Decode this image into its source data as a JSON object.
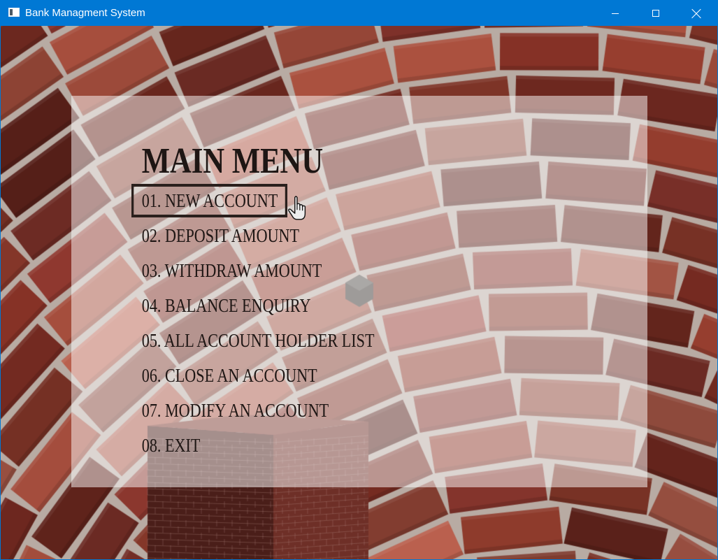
{
  "window": {
    "title": "Bank Managment System",
    "app_icon": "app-window-icon",
    "controls": {
      "minimize_icon": "minimize-icon",
      "maximize_icon": "maximize-icon",
      "close_icon": "close-icon"
    }
  },
  "menu": {
    "title": "MAIN MENU",
    "items": [
      {
        "label": "01. NEW ACCOUNT"
      },
      {
        "label": "02. DEPOSIT AMOUNT"
      },
      {
        "label": "03. WITHDRAW AMOUNT"
      },
      {
        "label": "04. BALANCE ENQUIRY"
      },
      {
        "label": "05. ALL ACCOUNT HOLDER LIST"
      },
      {
        "label": "06. CLOSE AN ACCOUNT"
      },
      {
        "label": "07. MODIFY AN ACCOUNT"
      },
      {
        "label": "08. EXIT"
      }
    ],
    "selected_index": 0
  },
  "pointer": {
    "icon": "hand-pointer-icon"
  },
  "colors": {
    "accent": "#0078d4",
    "menu_text": "#1e1614",
    "selection_border": "#2a201d",
    "panel_overlay": "rgba(255,255,255,0.5)",
    "brick": "#8b3a2e",
    "mortar": "#b8aba3"
  }
}
